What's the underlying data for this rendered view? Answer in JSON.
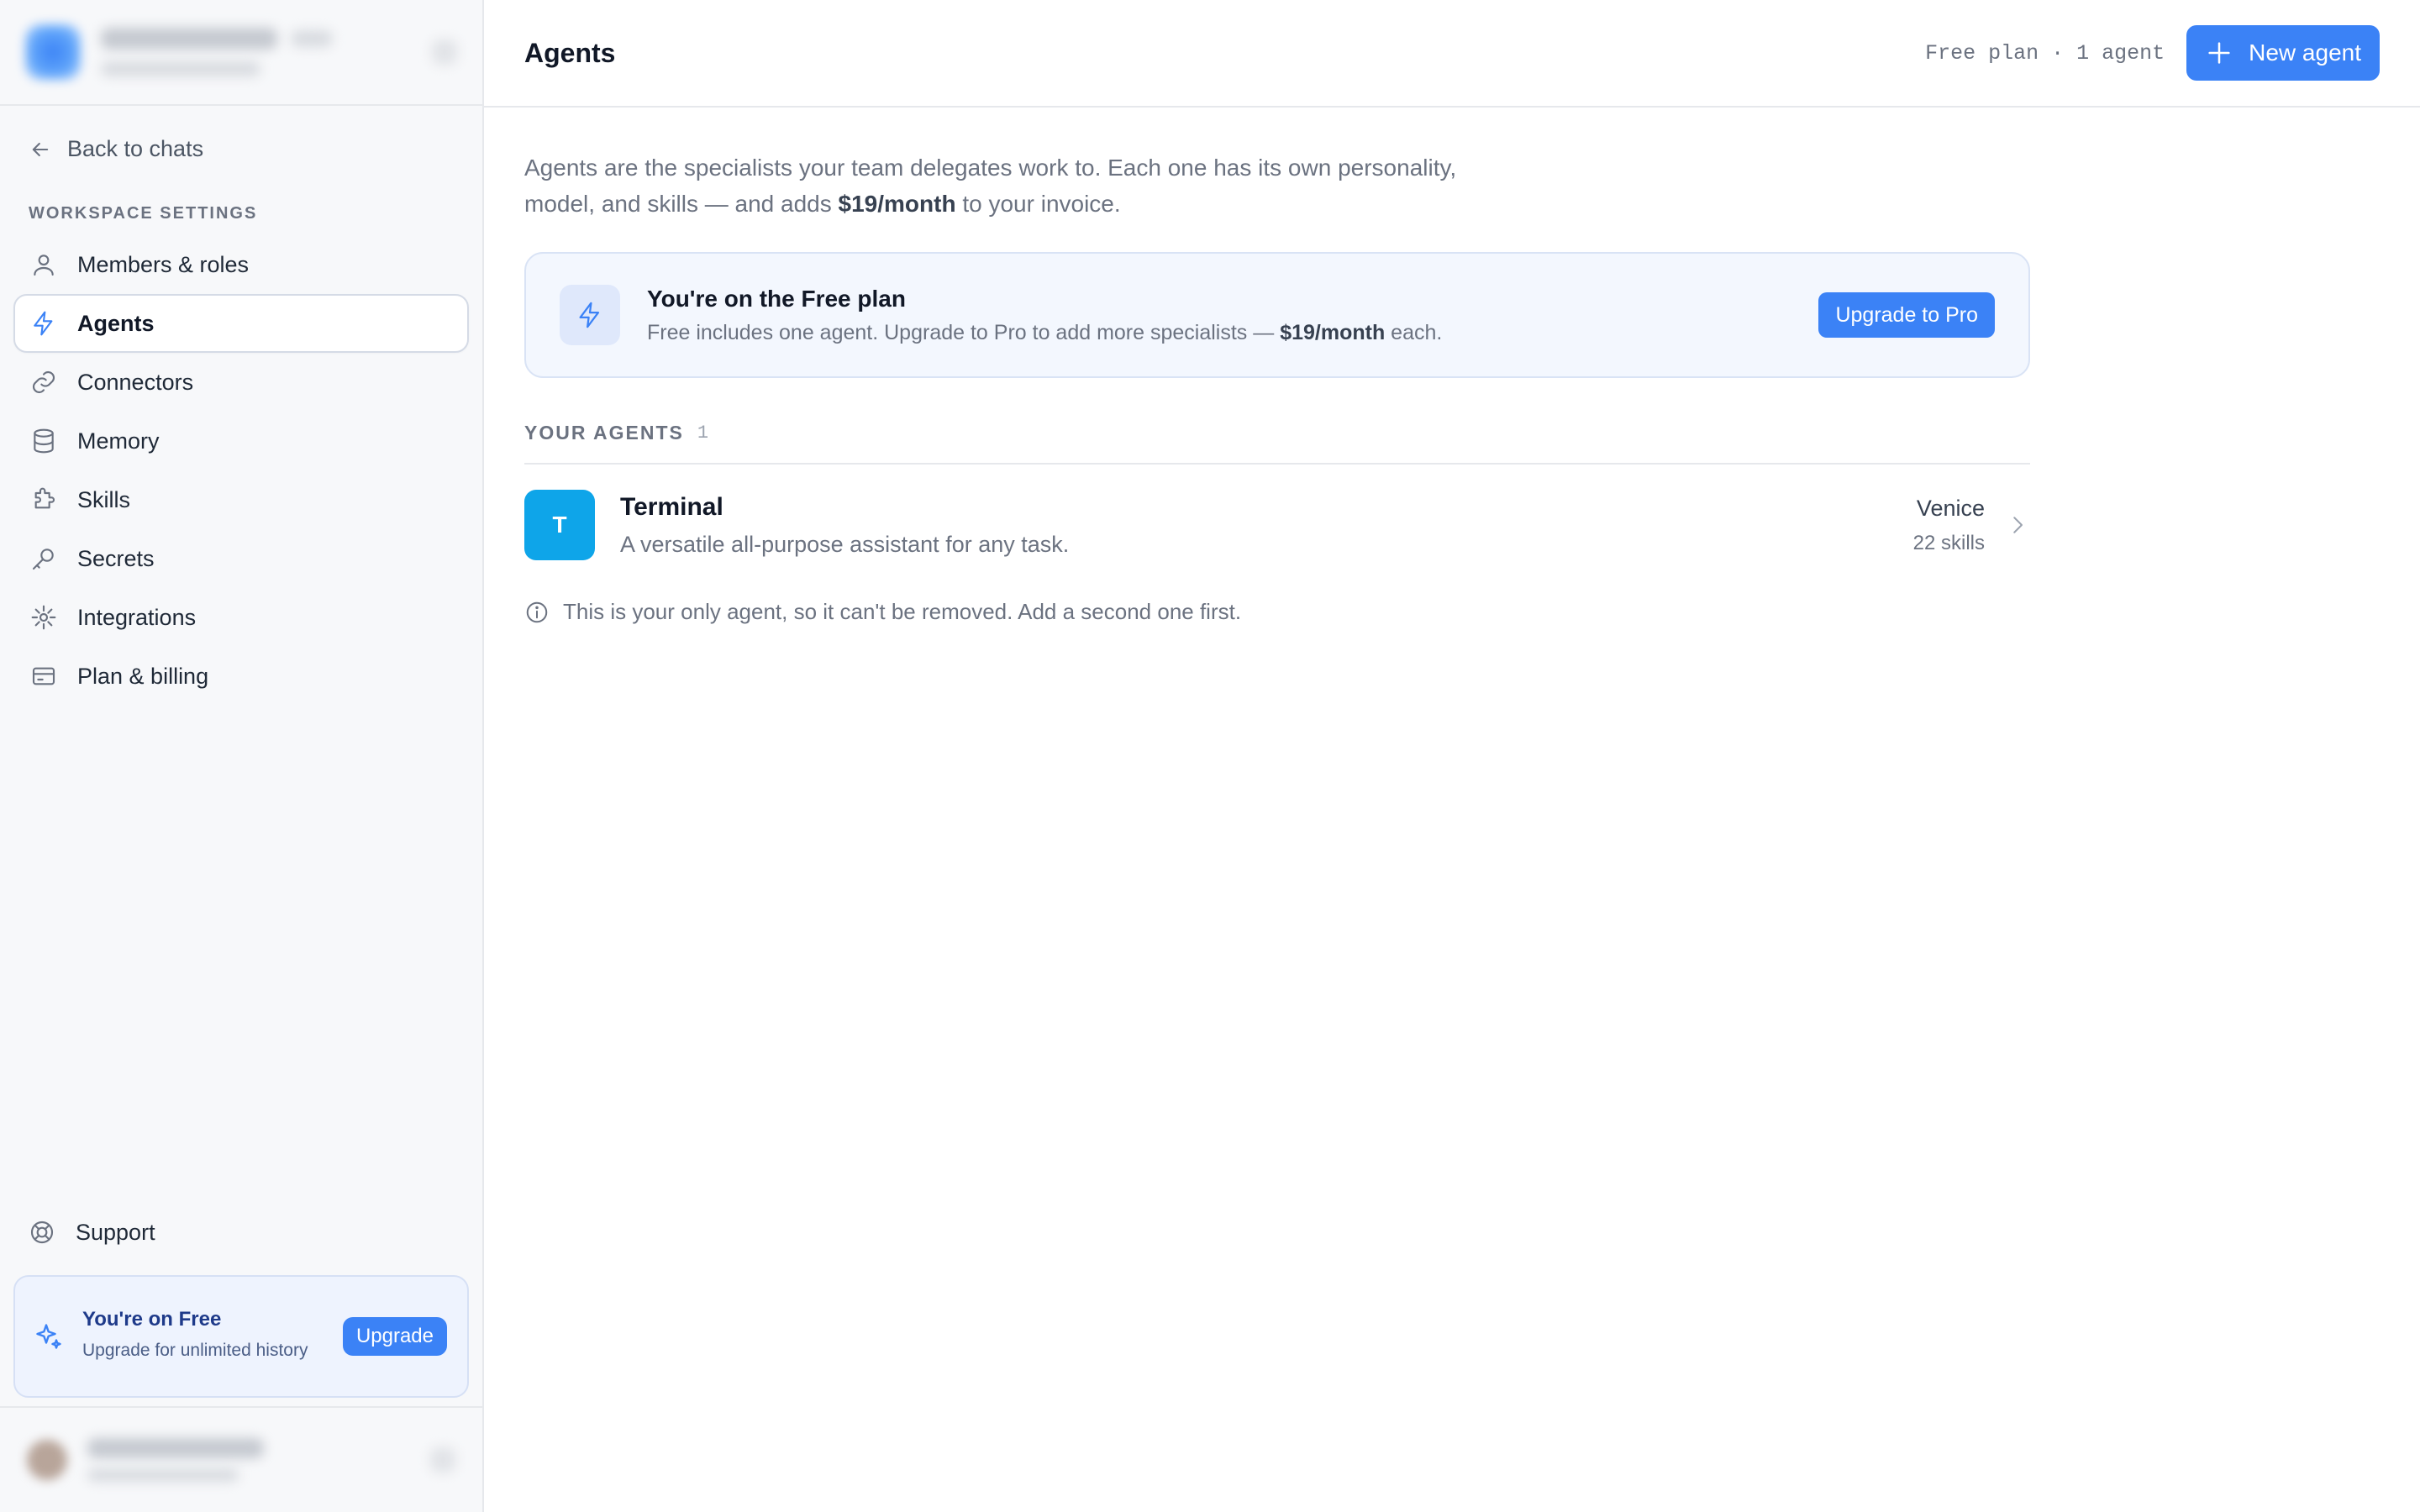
{
  "sidebar": {
    "back_label": "Back to chats",
    "section_label": "WORKSPACE SETTINGS",
    "items": [
      {
        "label": "Members & roles",
        "icon": "user-icon"
      },
      {
        "label": "Agents",
        "icon": "bolt-icon",
        "active": true
      },
      {
        "label": "Connectors",
        "icon": "link-icon"
      },
      {
        "label": "Memory",
        "icon": "database-icon"
      },
      {
        "label": "Skills",
        "icon": "puzzle-icon"
      },
      {
        "label": "Secrets",
        "icon": "key-icon"
      },
      {
        "label": "Integrations",
        "icon": "plug-icon"
      },
      {
        "label": "Plan & billing",
        "icon": "credit-card-icon"
      }
    ],
    "support_label": "Support",
    "upsell": {
      "title": "You're on Free",
      "subtitle": "Upgrade for unlimited history",
      "button": "Upgrade"
    }
  },
  "header": {
    "title": "Agents",
    "plan_meta": "Free plan · 1 agent",
    "new_agent_label": "New agent"
  },
  "intro": {
    "text_before": "Agents are the specialists your team delegates work to. Each one has its own personality, model, and skills — and adds ",
    "price": "$19/month",
    "text_after": " to your invoice."
  },
  "plan_card": {
    "title": "You're on the Free plan",
    "sub_before": "Free includes one agent. Upgrade to Pro to add more specialists — ",
    "sub_price": "$19/month",
    "sub_after": " each.",
    "button": "Upgrade to Pro"
  },
  "agents": {
    "heading": "YOUR AGENTS",
    "count": "1",
    "list": [
      {
        "initial": "T",
        "name": "Terminal",
        "description": "A versatile all-purpose assistant for any task.",
        "model": "Venice",
        "skills": "22 skills",
        "color": "#0ea5e9"
      }
    ],
    "note": "This is your only agent, so it can't be removed. Add a second one first."
  },
  "colors": {
    "accent": "#3b82f6",
    "agent_avatar": "#0ea5e9"
  }
}
